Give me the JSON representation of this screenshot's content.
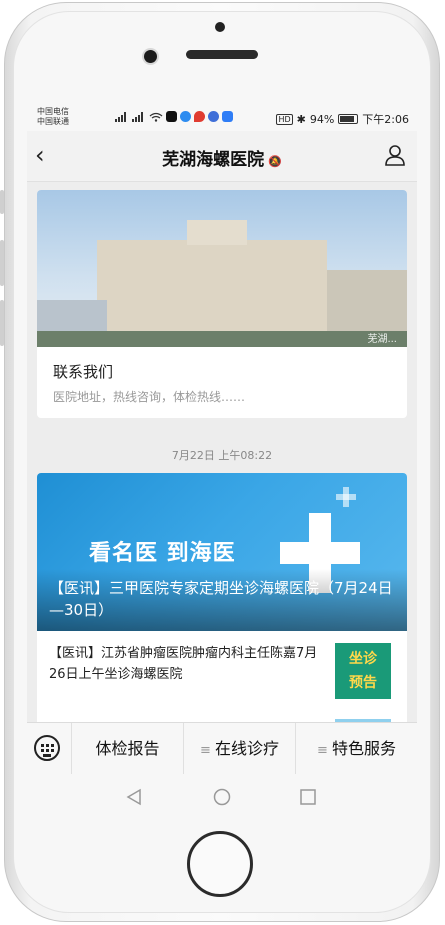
{
  "status_bar": {
    "carrier_1": "中国电信",
    "carrier_2": "中国联通",
    "battery": "94%",
    "time": "下午2:06"
  },
  "nav": {
    "title": "芜湖海螺医院"
  },
  "card_contact": {
    "title": "联系我们",
    "description": "医院地址，热线咨询，体检热线……",
    "watermark": "芜湖..."
  },
  "timestamp": "7月22日 上午08:22",
  "card_news": {
    "banner_slogan": "看名医 到海医",
    "caption": "【医讯】三甲医院专家定期坐诊海螺医院（7月24日—30日）",
    "item_text": "【医讯】江苏省肿瘤医院肿瘤内科主任陈嘉7月26日上午坐诊海螺医院",
    "thumb_line1": "坐诊",
    "thumb_line2": "预告"
  },
  "menu": {
    "items": [
      {
        "label": "体检报告",
        "has_submenu": false
      },
      {
        "label": "在线诊疗",
        "has_submenu": true
      },
      {
        "label": "特色服务",
        "has_submenu": true
      }
    ],
    "submenu_marker": "≡"
  },
  "colors": {
    "news_banner": "#3aa6e6",
    "thumb_bg": "#1a9a78",
    "thumb_text": "#ffd84a"
  }
}
